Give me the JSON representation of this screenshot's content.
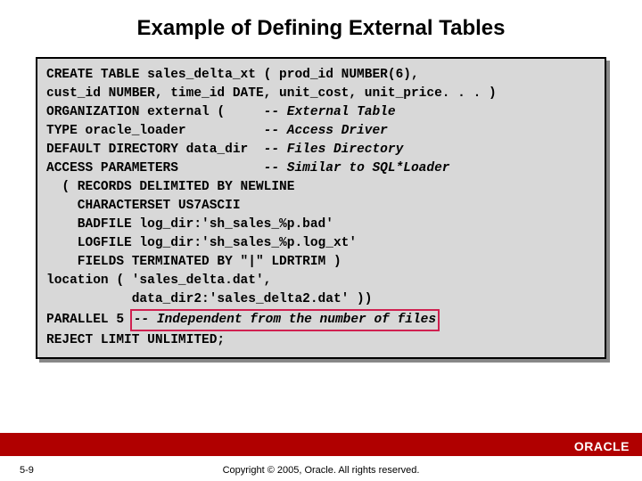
{
  "title": "Example of Defining External Tables",
  "code": {
    "l1": "CREATE TABLE sales_delta_xt ( prod_id NUMBER(6),",
    "l2": "cust_id NUMBER, time_id DATE, unit_cost, unit_price. . . )",
    "l3a": "ORGANIZATION external (",
    "l3c": "-- External Table",
    "l4a": "TYPE oracle_loader",
    "l4c": "-- Access Driver",
    "l5a": "DEFAULT DIRECTORY data_dir",
    "l5c": "-- Files Directory",
    "l6a": "ACCESS PARAMETERS",
    "l6c": "-- Similar to SQL*Loader",
    "l7": "  ( RECORDS DELIMITED BY NEWLINE",
    "l8": "    CHARACTERSET US7ASCII",
    "l9": "    BADFILE log_dir:'sh_sales_%p.bad'",
    "l10": "    LOGFILE log_dir:'sh_sales_%p.log_xt'",
    "l11": "    FIELDS TERMINATED BY \"|\" LDRTRIM )",
    "l12": "location ( 'sales_delta.dat',",
    "l13": "           data_dir2:'sales_delta2.dat' ))",
    "l14a": "PARALLEL 5 ",
    "l14b": "-- Independent from the number of files",
    "l15": "REJECT LIMIT UNLIMITED;"
  },
  "footer": {
    "page": "5-9",
    "copyright": "Copyright © 2005, Oracle. All rights reserved.",
    "logo": "ORACLE"
  }
}
